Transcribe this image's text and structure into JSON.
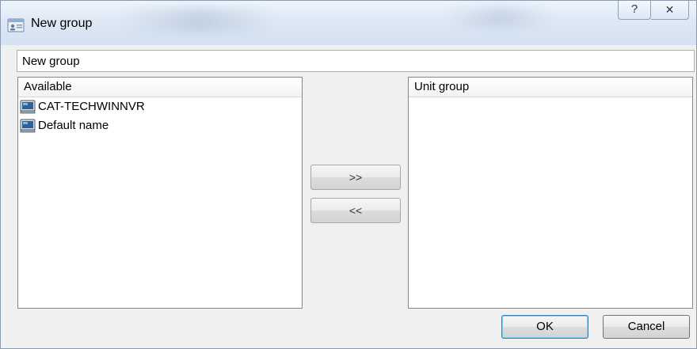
{
  "window": {
    "title": "New group",
    "help_glyph": "?",
    "close_glyph": "✕"
  },
  "name_field": {
    "value": "New group"
  },
  "available": {
    "header": "Available",
    "items": [
      {
        "label": "CAT-TECHWINNVR",
        "icon": "recorder-device-icon"
      },
      {
        "label": "Default name",
        "icon": "recorder-device-icon"
      }
    ]
  },
  "unit_group": {
    "header": "Unit group",
    "items": []
  },
  "transfer": {
    "add_label": ">>",
    "remove_label": "<<"
  },
  "dialog_buttons": {
    "ok_label": "OK",
    "cancel_label": "Cancel"
  },
  "colors": {
    "title_gradient_top": "#eef4fb",
    "title_gradient_bottom": "#d3e1f1",
    "ok_border": "#3c7fb1",
    "list_border": "#828790"
  }
}
